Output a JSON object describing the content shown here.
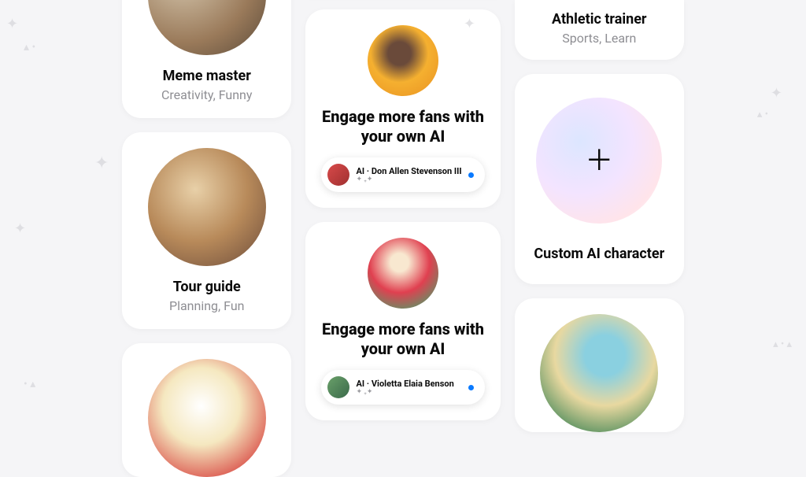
{
  "cards": {
    "meme": {
      "title": "Meme master",
      "subtitle": "Creativity, Funny"
    },
    "tour": {
      "title": "Tour guide",
      "subtitle": "Planning, Fun"
    },
    "athletic": {
      "title": "Athletic trainer",
      "subtitle": "Sports, Learn"
    },
    "custom": {
      "title": "Custom AI character"
    }
  },
  "promo": {
    "headline": "Engage more fans with your own AI",
    "items": [
      {
        "label": "AI · Don Allen Stevenson III",
        "sparkle": "✦ ₊✦"
      },
      {
        "label": "AI · Violetta Elaia Benson",
        "sparkle": "✦ ₊✦"
      }
    ]
  },
  "icons": {
    "plus": "＋"
  }
}
